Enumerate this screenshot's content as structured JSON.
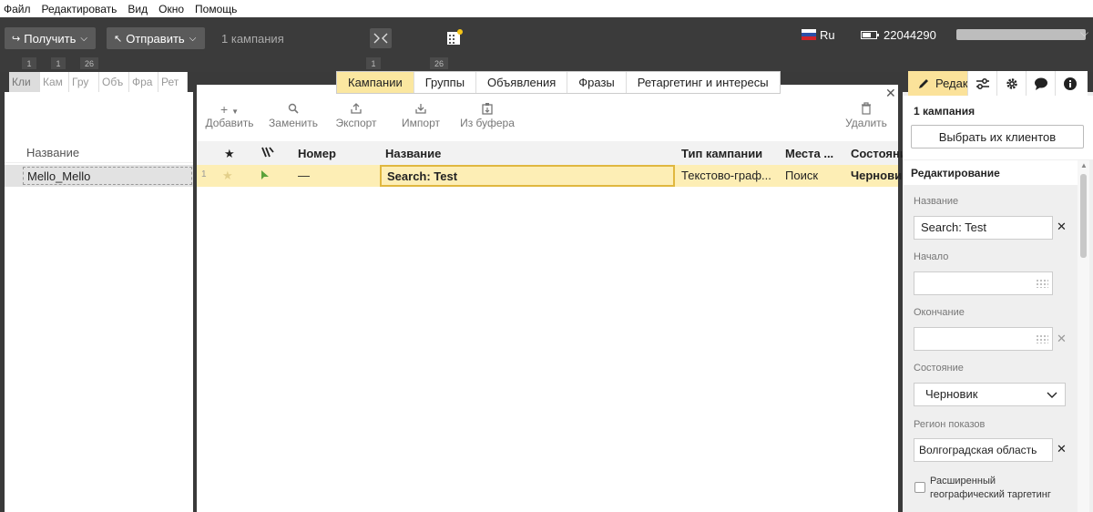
{
  "menu": [
    "Файл",
    "Редактировать",
    "Вид",
    "Окно",
    "Помощь"
  ],
  "toolbar": {
    "receive_label": "Получить",
    "send_label": "Отправить",
    "campaign_count": "1 кампания",
    "language": "Ru",
    "account_id": "22044290"
  },
  "badges": {
    "left_1": "1",
    "left_2": "1",
    "left_3": "26",
    "center_1": "1",
    "center_2": "26"
  },
  "left_tabs": [
    "Кли",
    "Кам",
    "Гру",
    "Объ",
    "Фра",
    "Рет"
  ],
  "left_panel": {
    "column_header": "Название",
    "client_name": "Mello_Mello"
  },
  "center_tabs": [
    "Кампании",
    "Группы",
    "Объявления",
    "Фразы",
    "Ретаргетинг и интересы"
  ],
  "actions": {
    "add": "Добавить",
    "replace": "Заменить",
    "export": "Экспорт",
    "import": "Импорт",
    "from_buffer": "Из буфера",
    "delete": "Удалить"
  },
  "table": {
    "headers": {
      "number": "Номер",
      "name": "Название",
      "type": "Тип кампании",
      "places": "Места ...",
      "state": "Состояни"
    },
    "rows": [
      {
        "index": "1",
        "number": "—",
        "name": "Search: Test",
        "type": "Текстово-граф...",
        "places": "Поиск",
        "state": "Чернови"
      }
    ]
  },
  "right_panel": {
    "tab_edit_label": "Редак",
    "selection_count": "1 кампания",
    "select_clients_button": "Выбрать их клиентов",
    "section_title": "Редактирование",
    "name_label": "Название",
    "name_value": "Search: Test",
    "start_label": "Начало",
    "end_label": "Окончание",
    "state_label": "Состояние",
    "state_value": "Черновик",
    "region_label": "Регион показов",
    "region_value": "Волгоградская область",
    "extended_geo_label": "Расширенный географический таргетинг"
  }
}
